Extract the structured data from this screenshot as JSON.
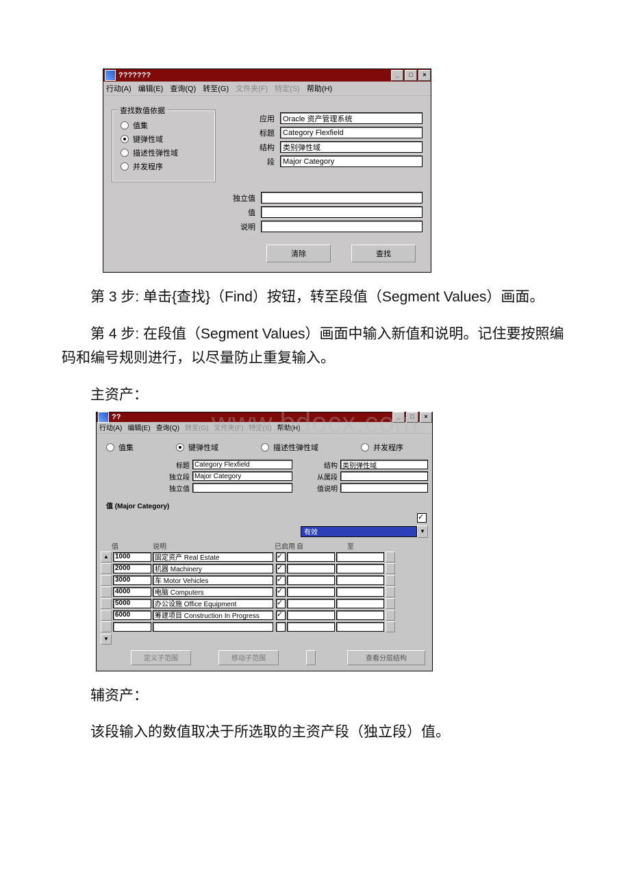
{
  "window1": {
    "title": "???????",
    "menus": {
      "action": "行动(A)",
      "edit": "编辑(E)",
      "query": "查询(Q)",
      "go": "转至(G)",
      "folder": "文件夹(F)",
      "special": "特定(S)",
      "help": "帮助(H)"
    },
    "group_title": "查找数值依据",
    "radios": {
      "valueset": "值集",
      "keyflex": "键弹性域",
      "descflex": "描述性弹性域",
      "concprog": "并发程序"
    },
    "fields": {
      "app_label": "应用",
      "app_value": "Oracle 资产管理系统",
      "title_label": "标题",
      "title_value": "Category Flexfield",
      "struct_label": "结构",
      "struct_value": "类别弹性域",
      "seg_label": "段",
      "seg_value": "Major Category",
      "indep_label": "独立值",
      "value_label": "值",
      "desc_label": "说明"
    },
    "buttons": {
      "clear": "清除",
      "find": "查找"
    }
  },
  "paragraphs": {
    "step3": "第 3 步: 单击{查找}（Find）按钮，转至段值（Segment Values）画面。",
    "step4": "第 4 步: 在段值（Segment Values）画面中输入新值和说明。记住要按照编码和编号规则进行，以尽量防止重复输入。",
    "main_asset": "主资产：",
    "sub_asset": "辅资产：",
    "sub_asset_note": "该段输入的数值取决于所选取的主资产段（独立段）值。"
  },
  "watermark": "www.bdocx.com",
  "window2": {
    "title": "??",
    "menus": {
      "action": "行动(A)",
      "edit": "编辑(E)",
      "query": "查询(Q)",
      "go": "转至(G)",
      "folder": "文件夹(F)",
      "special": "特定(S)",
      "help": "帮助(H)"
    },
    "radios2": {
      "valueset": "值集",
      "keyflex": "键弹性域",
      "descflex": "描述性弹性域",
      "concprog": "并发程序"
    },
    "left_fields": {
      "title_label": "标题",
      "title_value": "Category Flexfield",
      "indseg_label": "独立段",
      "indseg_value": "Major Category",
      "indval_label": "独立值",
      "indval_value": ""
    },
    "right_fields": {
      "struct_label": "结构",
      "struct_value": "类别弹性域",
      "dep_label": "从属段",
      "dep_value": "",
      "valdesc_label": "值说明",
      "valdesc_value": ""
    },
    "section_header": "值 (Major Category)",
    "valid_label": "有效",
    "columns": {
      "value": "值",
      "desc": "说明",
      "enabled": "已启用",
      "from": "自",
      "to": "至"
    },
    "rows": [
      {
        "value": "1000",
        "desc": "固定资产 Real Estate",
        "enabled": true
      },
      {
        "value": "2000",
        "desc": "机器 Machinery",
        "enabled": true
      },
      {
        "value": "3000",
        "desc": "车 Motor Vehicles",
        "enabled": true
      },
      {
        "value": "4000",
        "desc": "电脑 Computers",
        "enabled": true
      },
      {
        "value": "5000",
        "desc": "办公设施 Office Equipment",
        "enabled": true
      },
      {
        "value": "6000",
        "desc": "筹建项目 Construction In Progress",
        "enabled": true
      },
      {
        "value": "",
        "desc": "",
        "enabled": false
      }
    ],
    "buttons": {
      "def_sub": "定义子范围",
      "move_sub": "移动子范围",
      "view_hier": "查看分层结构"
    }
  }
}
